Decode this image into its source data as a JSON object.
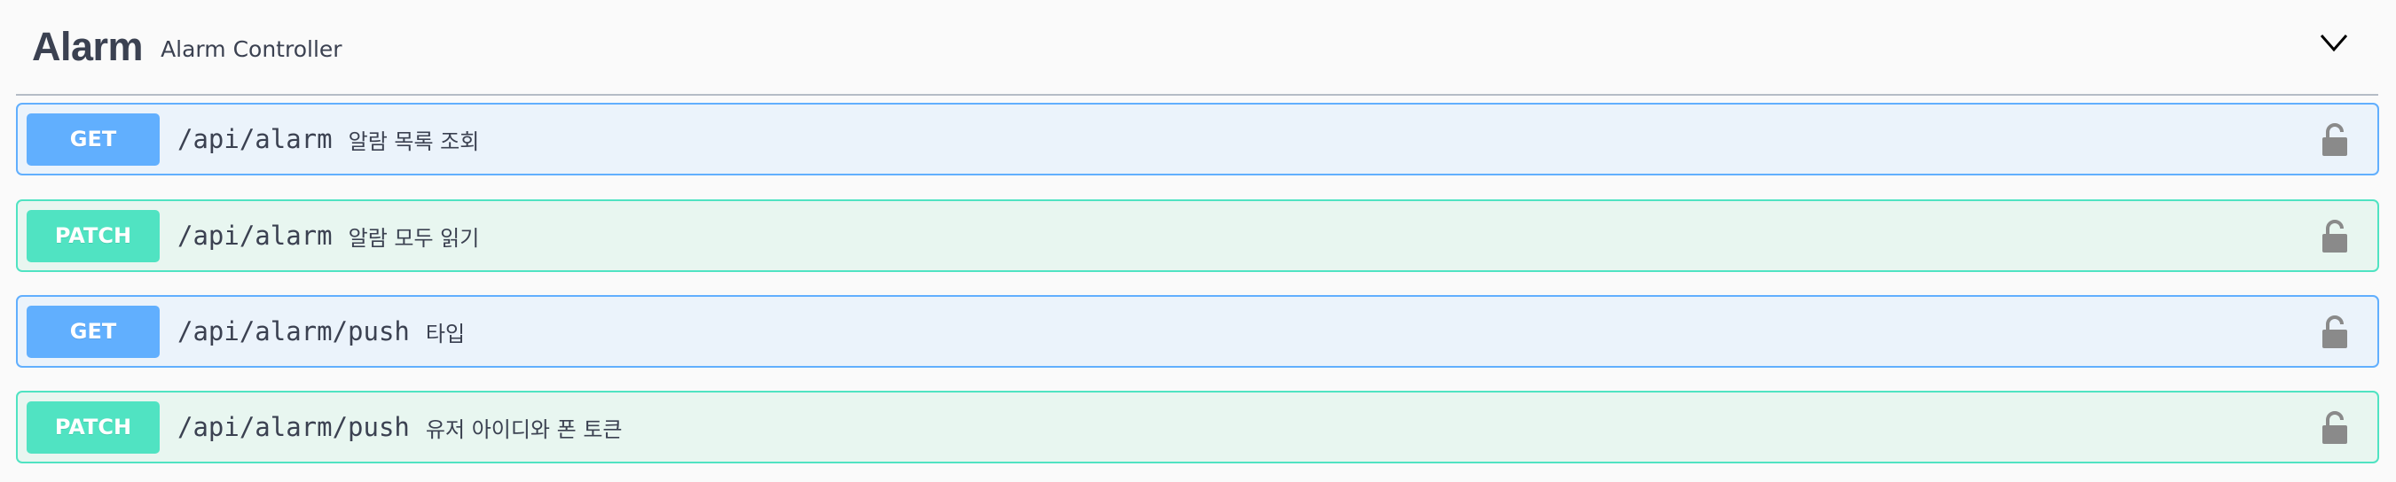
{
  "tag": {
    "name": "Alarm",
    "description": "Alarm Controller",
    "chevron_icon": "chevron-down-icon"
  },
  "operations": [
    {
      "method": "GET",
      "path": "/api/alarm",
      "summary": "알람 목록 조회",
      "icon": "lock-icon",
      "color": "#61affe"
    },
    {
      "method": "PATCH",
      "path": "/api/alarm",
      "summary": "알람 모두 읽기",
      "icon": "lock-icon",
      "color": "#50e3c2"
    },
    {
      "method": "GET",
      "path": "/api/alarm/push",
      "summary": "타입",
      "icon": "lock-icon",
      "color": "#61affe"
    },
    {
      "method": "PATCH",
      "path": "/api/alarm/push",
      "summary": "유저 아이디와 폰 토큰",
      "icon": "lock-icon",
      "color": "#50e3c2"
    }
  ]
}
